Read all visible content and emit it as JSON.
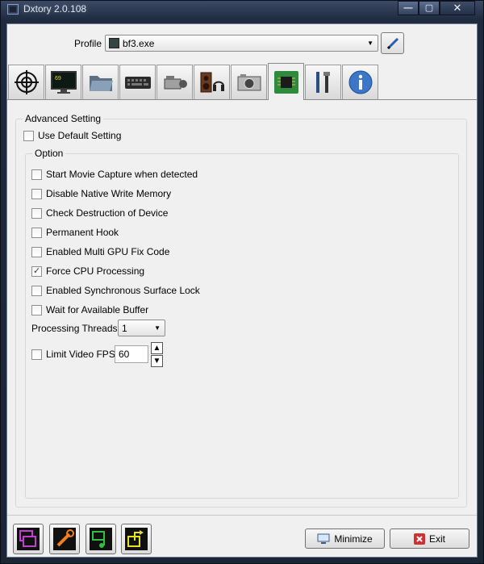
{
  "window": {
    "title": "Dxtory 2.0.108",
    "min_glyph": "—",
    "max_glyph": "▢",
    "close_glyph": "✕"
  },
  "profile": {
    "label": "Profile",
    "value": "bf3.exe"
  },
  "tabs": [
    {
      "icon": "crosshair-icon"
    },
    {
      "icon": "monitor-icon",
      "badge": "69"
    },
    {
      "icon": "folder-icon"
    },
    {
      "icon": "keyboard-icon"
    },
    {
      "icon": "camcorder-icon"
    },
    {
      "icon": "audio-speaker-icon"
    },
    {
      "icon": "camera-icon"
    },
    {
      "icon": "chip-icon",
      "active": true
    },
    {
      "icon": "tools-icon"
    },
    {
      "icon": "info-icon"
    }
  ],
  "advanced": {
    "title": "Advanced Setting",
    "use_default": {
      "label": "Use Default Setting",
      "checked": false
    }
  },
  "option": {
    "title": "Option",
    "checkboxes": [
      {
        "label": "Start Movie Capture when detected",
        "checked": false
      },
      {
        "label": "Disable Native Write Memory",
        "checked": false
      },
      {
        "label": "Check Destruction of Device",
        "checked": false
      },
      {
        "label": "Permanent Hook",
        "checked": false
      },
      {
        "label": "Enabled Multi GPU Fix Code",
        "checked": false
      },
      {
        "label": "Force CPU Processing",
        "checked": true
      },
      {
        "label": "Enabled Synchronous Surface Lock",
        "checked": false
      },
      {
        "label": "Wait for Available Buffer",
        "checked": false
      }
    ],
    "processing_threads": {
      "label": "Processing Threads",
      "value": "1"
    },
    "limit_fps": {
      "label": "Limit Video FPS",
      "checked": false,
      "value": "60"
    }
  },
  "bottom": {
    "quick_buttons": [
      {
        "icon": "overlay-windows-icon",
        "color": "#c040d0"
      },
      {
        "icon": "wrench-icon",
        "color": "#f08020"
      },
      {
        "icon": "music-folder-icon",
        "color": "#30c040"
      },
      {
        "icon": "export-icon",
        "color": "#e8e020"
      }
    ],
    "minimize_label": "Minimize",
    "exit_label": "Exit"
  },
  "colors": {
    "frame": "#1f2a3e",
    "client": "#f0f0f0",
    "exit_icon": "#d03030"
  }
}
